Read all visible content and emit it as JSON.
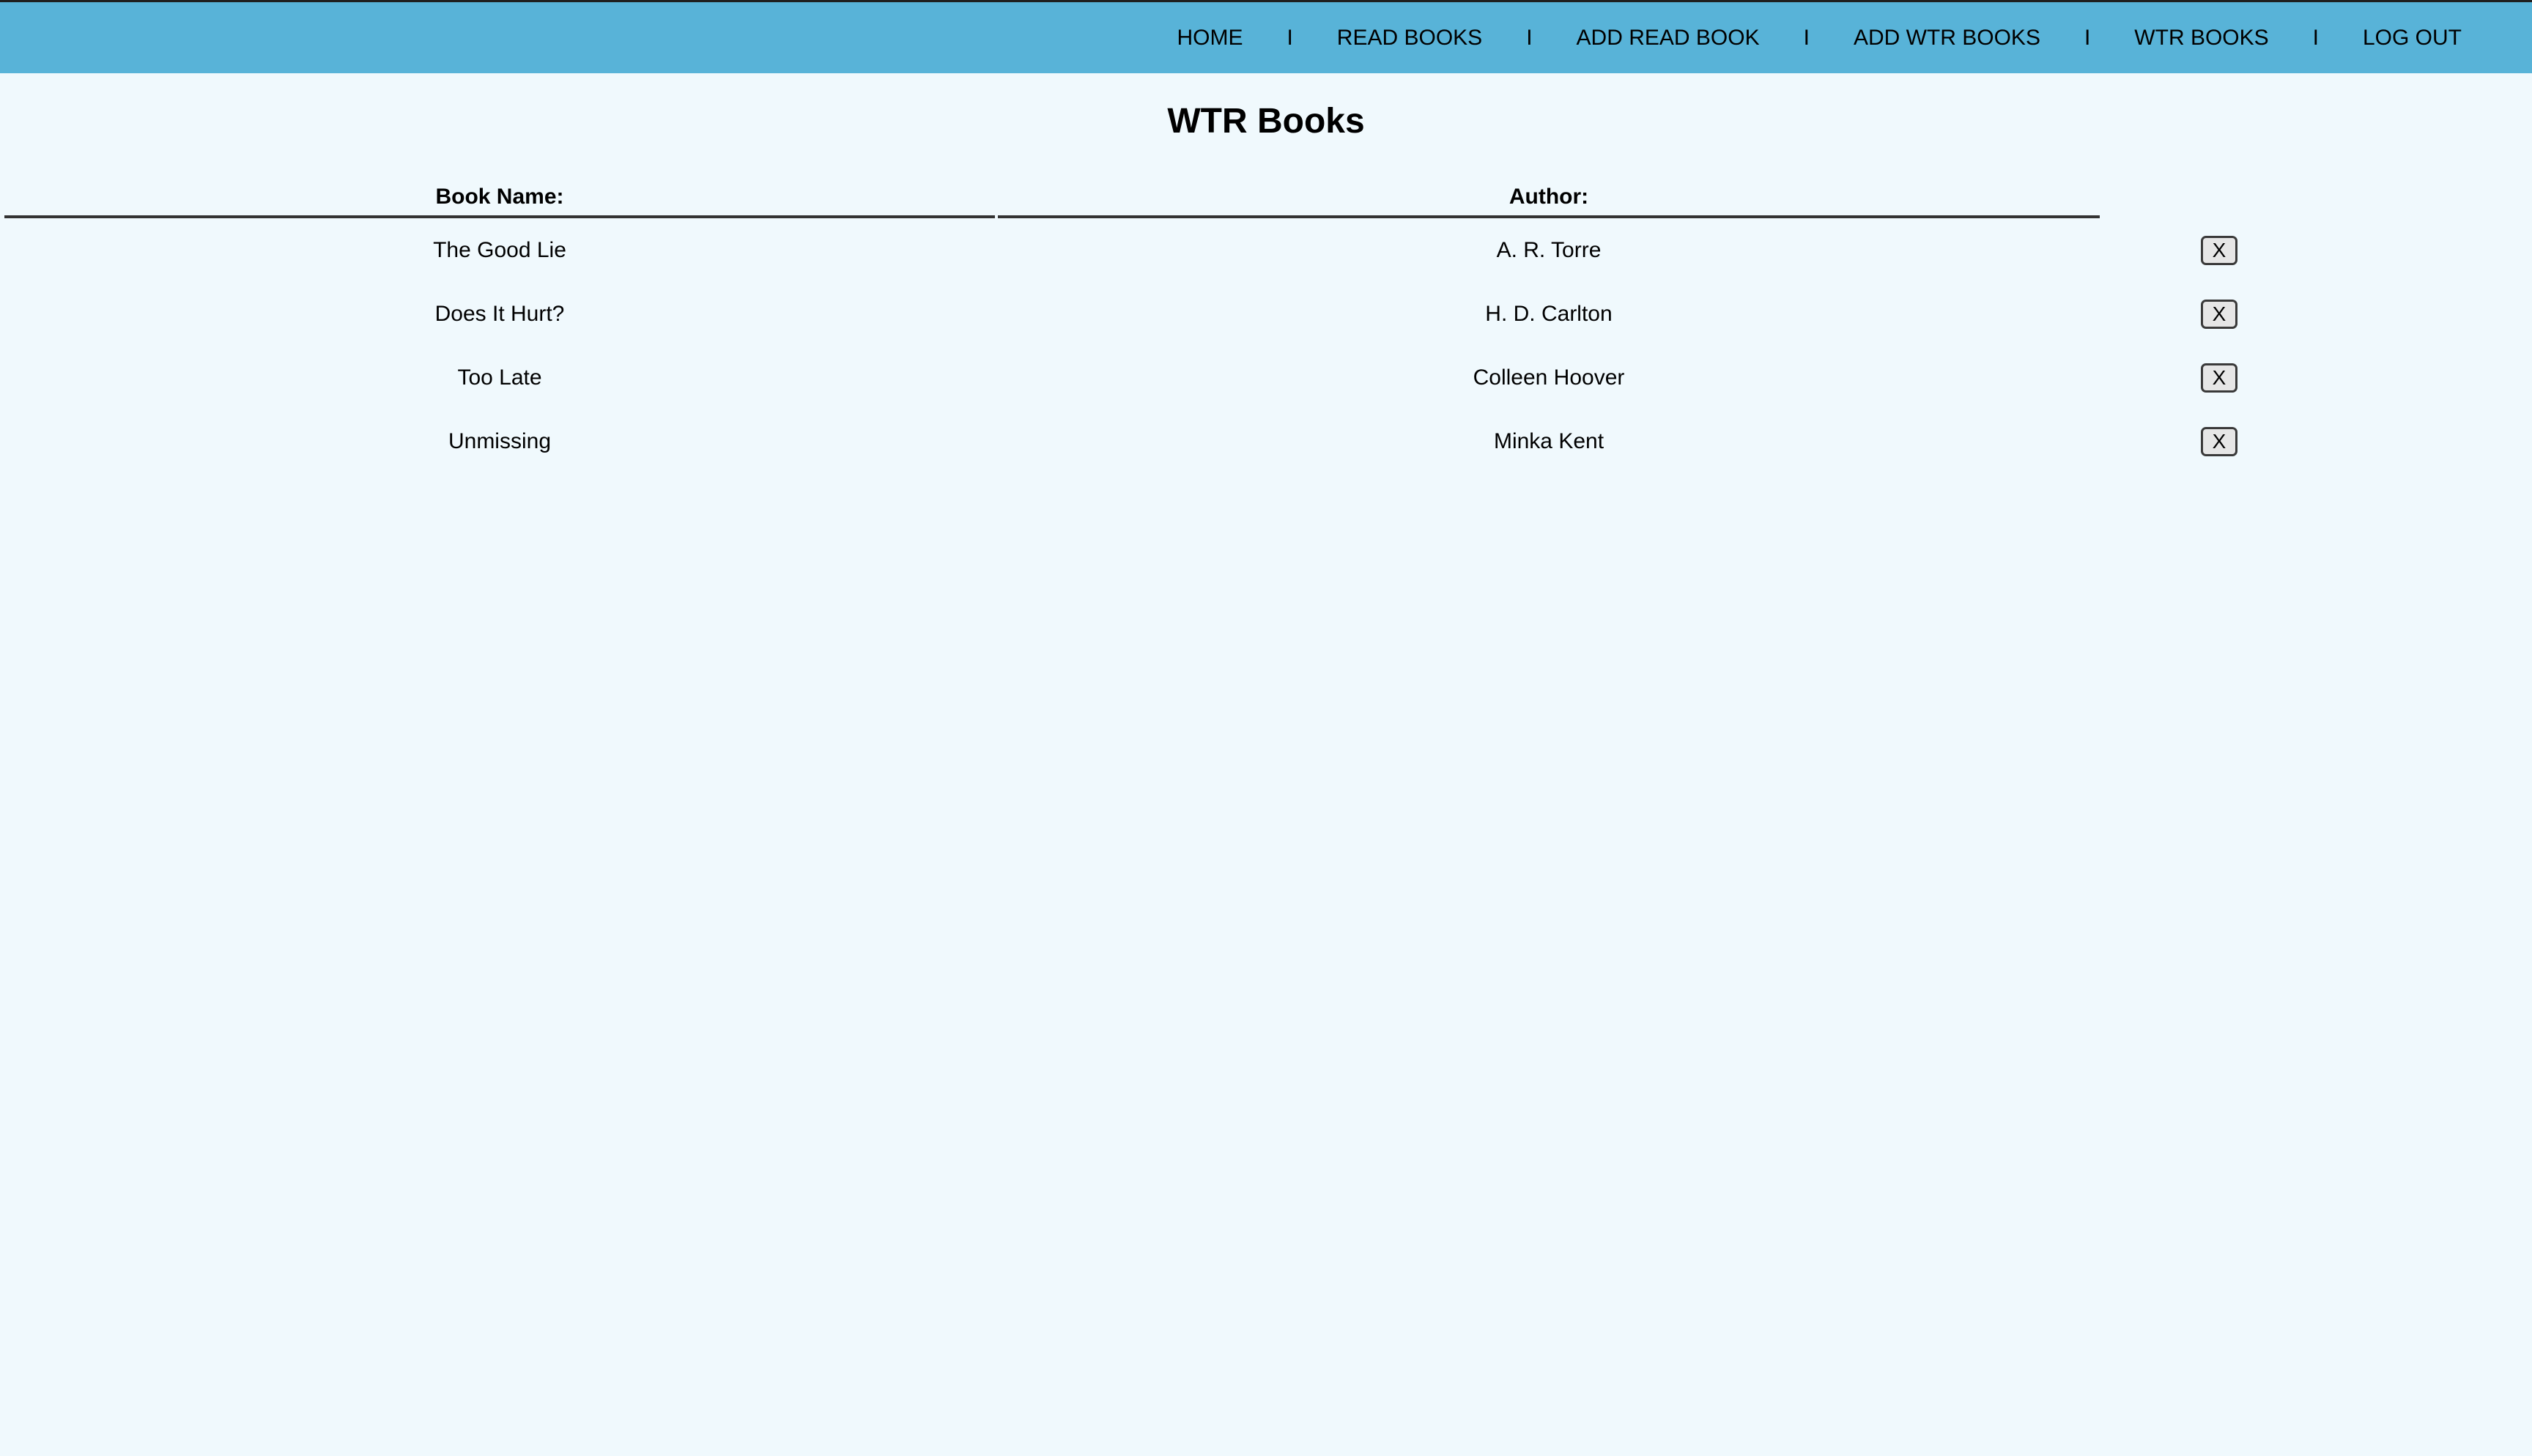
{
  "nav": {
    "home": "HOME",
    "read_books": "READ BOOKS",
    "add_read_book": "ADD READ BOOK",
    "add_wtr_books": "ADD WTR BOOKS",
    "wtr_books": "WTR BOOKS",
    "log_out": "LOG OUT",
    "separator": "I"
  },
  "page": {
    "title": "WTR Books"
  },
  "table": {
    "headers": {
      "book_name": "Book Name:",
      "author": "Author:"
    },
    "rows": [
      {
        "book": "The Good Lie",
        "author": "A. R. Torre",
        "delete": "X"
      },
      {
        "book": "Does It Hurt?",
        "author": "H. D. Carlton",
        "delete": "X"
      },
      {
        "book": "Too Late",
        "author": "Colleen Hoover",
        "delete": "X"
      },
      {
        "book": "Unmissing",
        "author": "Minka Kent",
        "delete": "X"
      }
    ]
  },
  "colors": {
    "navbar": "#58b3d8",
    "background": "#f0f9fd"
  }
}
